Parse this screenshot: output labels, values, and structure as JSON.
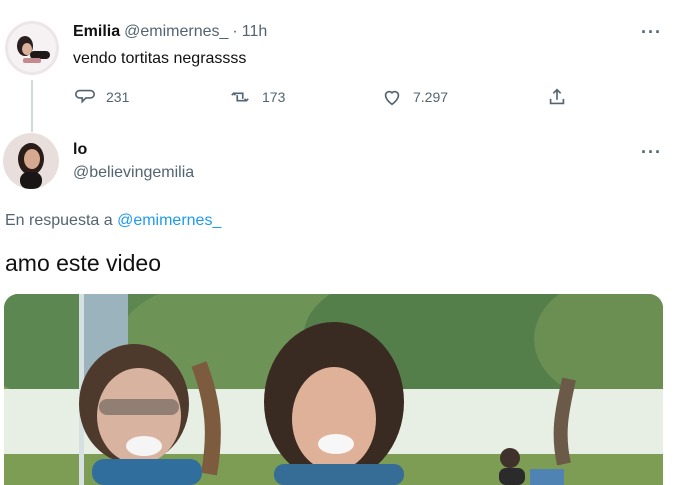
{
  "tweet": {
    "display_name": "Emilia",
    "handle": "@emimernes_",
    "separator": "·",
    "time": "11h",
    "text": "vendo tortitas negrassss",
    "reply_count": "231",
    "retweet_count": "173",
    "like_count": "7.297",
    "icons": [
      "reply-icon",
      "retweet-icon",
      "like-icon",
      "share-icon",
      "more-icon"
    ]
  },
  "reply": {
    "display_name": "lo",
    "handle": "@believingemilia",
    "replying_prefix": "En respuesta a",
    "replying_handle": "@emimernes_",
    "text": "amo este video"
  },
  "colors": {
    "link": "#1d9bf0",
    "muted": "#536471",
    "text": "#0f1419"
  }
}
